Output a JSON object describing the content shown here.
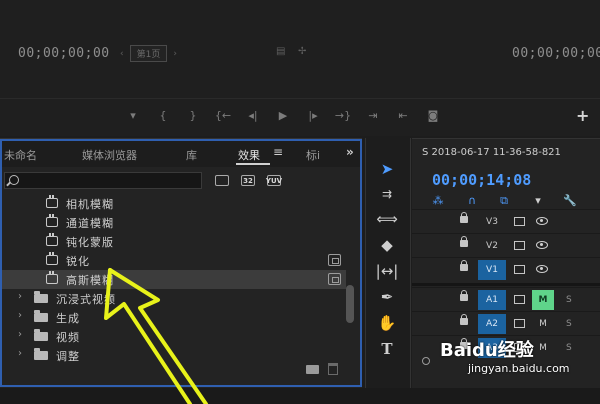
{
  "monitor": {
    "timecode_left": "00;00;00;00",
    "timecode_right": "00;00;00;00",
    "fit_prefix_glyph": "‹",
    "fit_label": "第1页",
    "settings_glyph": "›",
    "export_glyph": "▤",
    "wrench_glyph": "✢",
    "transport": [
      "▾",
      "{",
      "}",
      "{←",
      "◂|",
      "▶",
      "|▸",
      "→}",
      "⇥",
      "⇤",
      "◙"
    ],
    "plus_glyph": "+"
  },
  "panel": {
    "tabs": [
      "未命名",
      "媒体浏览器",
      "库",
      "效果",
      "标i"
    ],
    "menu_glyph": "≡",
    "overflow_glyph": "»",
    "filters": [
      "",
      "32",
      "YUV"
    ],
    "effects": [
      "相机模糊",
      "通道模糊",
      "钝化蒙版",
      "锐化",
      "高斯模糊"
    ],
    "folders": [
      "沉浸式视频",
      "生成",
      "视频",
      "调整"
    ],
    "chevron_glyph": "›"
  },
  "tools": [
    "➤",
    "⇉",
    "⟺",
    "◆",
    "|↔|",
    "✒",
    "✋",
    "T"
  ],
  "timeline": {
    "sequence_tab": "S 2018-06-17 11-36-58-821",
    "timecode": "00;00;14;08",
    "tool_glyphs": [
      "⁂",
      "∩",
      "⧉",
      "▾",
      "🔧"
    ],
    "video_tracks": [
      "V3",
      "V2",
      "V1"
    ],
    "audio_tracks": [
      "A1",
      "A2",
      "A3"
    ],
    "mute_label": "M",
    "solo_label": "S"
  },
  "watermark": {
    "brand": "Baidu经验",
    "url": "jingyan.baidu.com"
  },
  "colors": {
    "panel_focus_border": "#2f5fb0",
    "timeline_timecode": "#4f9cff",
    "targeted_track": "#1b63a0",
    "mute_active": "#5fd48a",
    "annotation_arrow": "#e8f21a"
  }
}
